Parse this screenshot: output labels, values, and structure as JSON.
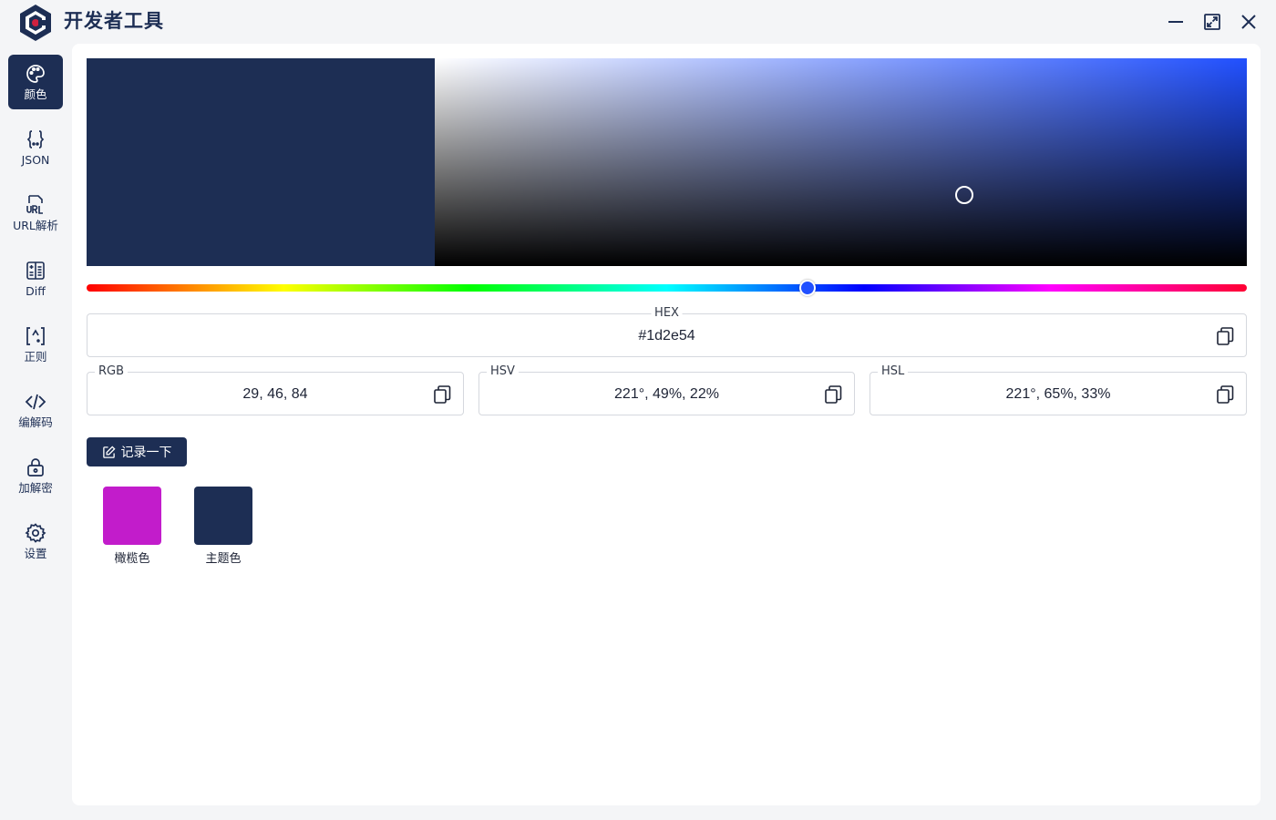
{
  "app": {
    "title": "开发者工具"
  },
  "sidebar": {
    "items": [
      {
        "label": "颜色",
        "icon": "palette-icon",
        "active": true
      },
      {
        "label": "JSON",
        "icon": "braces-icon"
      },
      {
        "label": "URL解析",
        "icon": "url-icon"
      },
      {
        "label": "Diff",
        "icon": "diff-icon"
      },
      {
        "label": "正则",
        "icon": "regex-icon"
      },
      {
        "label": "编解码",
        "icon": "code-icon"
      },
      {
        "label": "加解密",
        "icon": "lock-icon"
      },
      {
        "label": "设置",
        "icon": "gear-icon"
      }
    ]
  },
  "picker": {
    "current_color": "#1d2e54",
    "hue_color": "#2150ff",
    "hue_degrees": 221,
    "saturation_percent": 65,
    "value_percent": 33
  },
  "fields": {
    "hex": {
      "label": "HEX",
      "value": "#1d2e54"
    },
    "rgb": {
      "label": "RGB",
      "value": "29, 46, 84"
    },
    "hsv": {
      "label": "HSV",
      "value": "221°, 49%, 22%"
    },
    "hsl": {
      "label": "HSL",
      "value": "221°, 65%, 33%"
    }
  },
  "record_button": {
    "label": "记录一下"
  },
  "swatches": [
    {
      "label": "橄榄色",
      "color": "#c21ccb"
    },
    {
      "label": "主题色",
      "color": "#1d2e54"
    }
  ],
  "colors": {
    "accent": "#1d2e54"
  }
}
